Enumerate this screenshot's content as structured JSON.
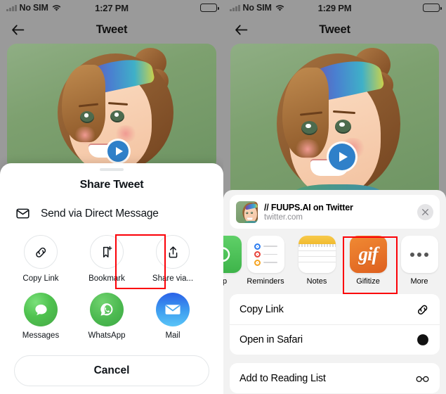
{
  "left": {
    "status": {
      "carrier": "No SIM",
      "time": "1:27 PM",
      "wifi_icon": "wifi-icon",
      "battery_icon": "battery-icon",
      "signal_icon": "signal-bars-icon"
    },
    "nav": {
      "back_icon": "back-arrow-icon",
      "title": "Tweet"
    },
    "media": {
      "play_icon": "play-button-icon",
      "alt": "illustrated smiling girl with rainbow headband"
    },
    "sheet": {
      "handle": "grabber-handle",
      "title": "Share Tweet",
      "dm": {
        "icon": "envelope-icon",
        "label": "Send via Direct Message"
      },
      "actions": [
        {
          "icon": "link-icon",
          "label": "Copy Link",
          "highlighted": false
        },
        {
          "icon": "bookmark-plus-icon",
          "label": "Bookmark",
          "highlighted": false
        },
        {
          "icon": "share-up-arrow-icon",
          "label": "Share via...",
          "highlighted": true
        }
      ],
      "apps": [
        {
          "icon": "messages-app-icon",
          "label": "Messages"
        },
        {
          "icon": "whatsapp-app-icon",
          "label": "WhatsApp"
        },
        {
          "icon": "mail-app-icon",
          "label": "Mail"
        }
      ],
      "cancel_label": "Cancel"
    }
  },
  "right": {
    "status": {
      "carrier": "No SIM",
      "time": "1:29 PM",
      "wifi_icon": "wifi-icon",
      "battery_icon": "battery-icon",
      "signal_icon": "signal-bars-icon"
    },
    "nav": {
      "back_icon": "back-arrow-icon",
      "title": "Tweet"
    },
    "media": {
      "play_icon": "play-button-icon",
      "alt": "illustrated smiling girl with rainbow headband"
    },
    "sheet": {
      "link": {
        "thumb": "tweet-thumbnail",
        "title": "// FUUPS.AI on Twitter",
        "subtitle": "twitter.com",
        "close_icon": "close-icon"
      },
      "apps": [
        {
          "icon": "whatsapp-app-icon",
          "label": "pp",
          "clipped": true,
          "highlighted": false
        },
        {
          "icon": "reminders-app-icon",
          "label": "Reminders",
          "clipped": false,
          "highlighted": false
        },
        {
          "icon": "notes-app-icon",
          "label": "Notes",
          "clipped": false,
          "highlighted": false
        },
        {
          "icon": "gifitize-app-icon",
          "label": "Gifitize",
          "clipped": false,
          "highlighted": true,
          "glyph": "gif"
        },
        {
          "icon": "more-icon",
          "label": "More",
          "clipped": false,
          "highlighted": false
        }
      ],
      "activities": [
        {
          "label": "Copy Link",
          "icon": "link-icon"
        },
        {
          "label": "Open in Safari",
          "icon": "safari-icon"
        },
        {
          "label": "Add to Reading List",
          "icon": "glasses-icon"
        }
      ]
    }
  },
  "colors": {
    "highlight": "#fb0007",
    "backdrop": "#9a9a9a",
    "ios_sheet_bg": "#f2f2f2",
    "twitter_text": "#0f1419",
    "play_blue": "#2f80c9",
    "gif_orange": "#e8762a"
  }
}
